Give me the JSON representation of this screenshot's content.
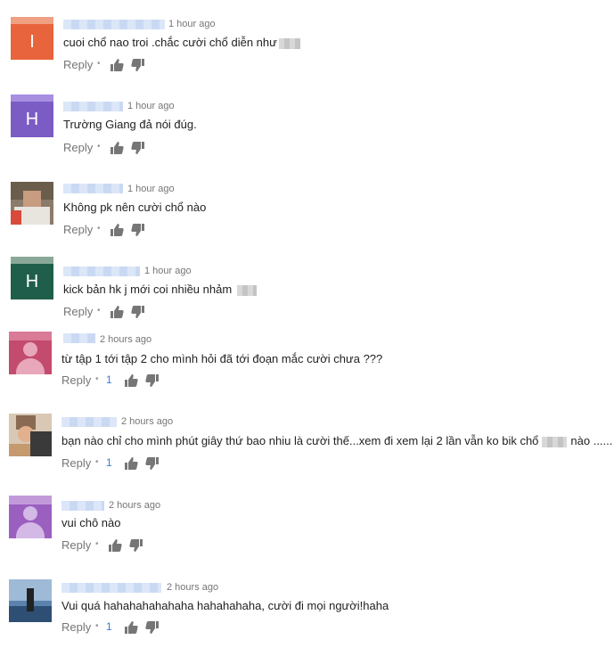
{
  "comments": [
    {
      "time": "1 hour ago",
      "text": "cuoi chổ nao troi .chắc cười chổ diễn như",
      "reply": "Reply",
      "likes": "",
      "avatar_letter": "I",
      "avatar_color": "#e8643c"
    },
    {
      "time": "1 hour ago",
      "text": "Trường Giang đả nói đúg.",
      "reply": "Reply",
      "likes": "",
      "avatar_letter": "H",
      "avatar_color": "#7b5cc4"
    },
    {
      "time": "1 hour ago",
      "text": "Không pk nên cười chổ nào",
      "reply": "Reply",
      "likes": "",
      "avatar_letter": "",
      "avatar_color": "#8a7b6a"
    },
    {
      "time": "1 hour ago",
      "text": "kick bản hk j mới coi nhiều nhảm",
      "reply": "Reply",
      "likes": "",
      "avatar_letter": "H",
      "avatar_color": "#1f5e4a"
    },
    {
      "time": "2 hours ago",
      "text": "từ tập 1 tới tập 2 cho mình hỏi đã tới đoạn mắc cười chưa ???",
      "reply": "Reply",
      "likes": "1",
      "avatar_letter": "",
      "avatar_color": "#c24b6e"
    },
    {
      "time": "2 hours ago",
      "text": "bạn nào chỉ cho mình phút giây thứ bao nhiu là cười thế...xem đi xem lại 2 lần vẫn ko bik chổ",
      "text_after": "nào ......",
      "reply": "Reply",
      "likes": "1",
      "avatar_letter": "",
      "avatar_color": "#b79a7a"
    },
    {
      "time": "2 hours ago",
      "text": "vui chô nào",
      "reply": "Reply",
      "likes": "",
      "avatar_letter": "",
      "avatar_color": "#9b5fc0"
    },
    {
      "time": "2 hours ago",
      "text": "Vui quá hahahahahahaha hahahahaha, cười đi mọi người!haha",
      "reply": "Reply",
      "likes": "1",
      "avatar_letter": "",
      "avatar_color": "#5a82ad"
    }
  ]
}
